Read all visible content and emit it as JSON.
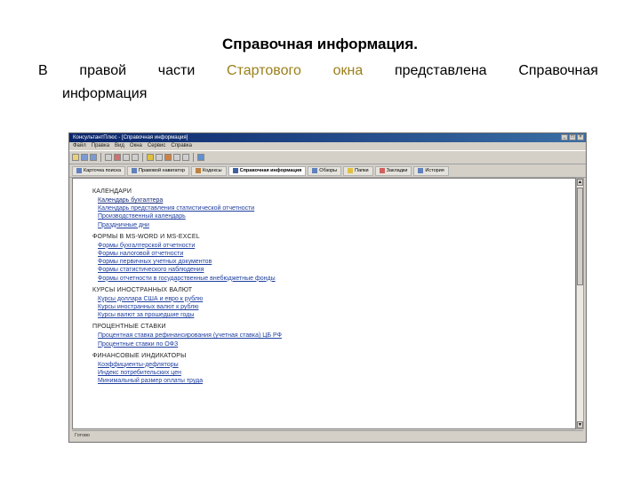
{
  "slide": {
    "title": "Справочная информация.",
    "line1": [
      "В",
      "правой",
      "части",
      "Стартового",
      "окна",
      "представлена",
      "Справочная"
    ],
    "line2": "информация"
  },
  "window": {
    "title": "КонсультантПлюс - [Справочная информация]",
    "menu": [
      "Файл",
      "Правка",
      "Вид",
      "Окна",
      "Сервис",
      "Справка"
    ],
    "tabs": [
      {
        "label": "Карточка поиска",
        "icon": "search-card-icon"
      },
      {
        "label": "Правовой навигатор",
        "icon": "navigator-icon"
      },
      {
        "label": "Кодексы",
        "icon": "codex-icon"
      },
      {
        "label": "Справочная информация",
        "icon": "info-icon",
        "active": true
      },
      {
        "label": "Обзоры",
        "icon": "reviews-icon"
      },
      {
        "label": "Папки",
        "icon": "folder-icon"
      },
      {
        "label": "Закладки",
        "icon": "bookmark-icon"
      },
      {
        "label": "История",
        "icon": "history-icon"
      }
    ],
    "status": "Готово",
    "colors": {
      "titlebar": "#0a246a",
      "link": "#1f3f9f",
      "highlight": "#9a7f1a"
    }
  },
  "info_sections": [
    {
      "heading": "КАЛЕНДАРИ",
      "links": [
        "Календарь бухгалтера",
        "Календарь представления статистической отчетности",
        "Производственный календарь",
        "Праздничные дни"
      ]
    },
    {
      "heading": "ФОРМЫ В MS-WORD И MS-EXCEL",
      "links": [
        "Формы бухгалтерской отчетности",
        "Формы налоговой отчетности",
        "Формы первичных учетных документов",
        "Формы статистического наблюдения",
        "Формы отчетности в государственные внебюджетные фонды"
      ]
    },
    {
      "heading": "КУРСЫ ИНОСТРАННЫХ ВАЛЮТ",
      "links": [
        "Курсы доллара США и евро к рублю",
        "Курсы иностранных валют к рублю",
        "Курсы валют за прошедшие годы"
      ]
    },
    {
      "heading": "ПРОЦЕНТНЫЕ СТАВКИ",
      "links": [
        "Процентная ставка рефинансирования (учетная ставка) ЦБ РФ",
        "Процентные ставки по ОФЗ"
      ]
    },
    {
      "heading": "ФИНАНСОВЫЕ ИНДИКАТОРЫ",
      "links": [
        "Коэффициенты-дефляторы",
        "Индекс потребительских цен",
        "Минимальный размер оплаты труда"
      ]
    }
  ]
}
